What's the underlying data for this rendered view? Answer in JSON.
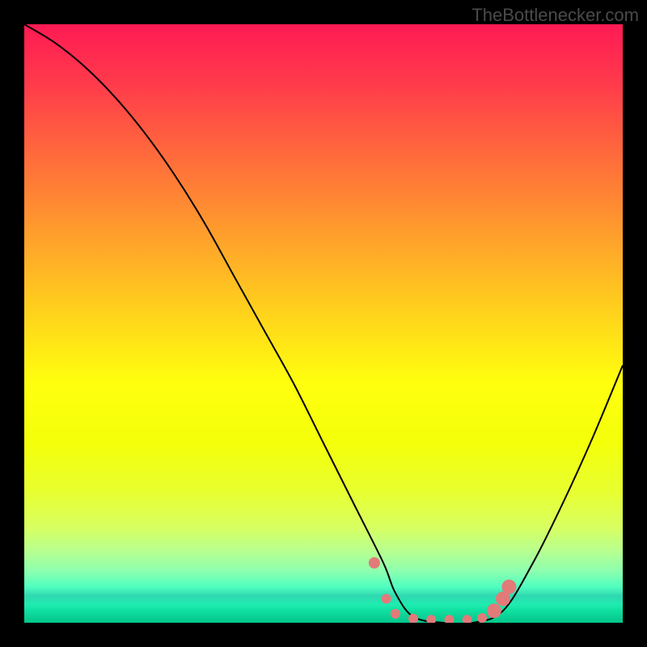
{
  "watermark": "TheBottlenecker.com",
  "chart_data": {
    "type": "line",
    "title": "",
    "xlabel": "",
    "ylabel": "",
    "xlim": [
      0,
      100
    ],
    "ylim": [
      0,
      100
    ],
    "series": [
      {
        "name": "curve",
        "x": [
          0,
          5,
          10,
          15,
          20,
          25,
          30,
          35,
          40,
          45,
          50,
          55,
          60,
          62,
          65,
          70,
          75,
          80,
          85,
          90,
          95,
          100
        ],
        "values": [
          100,
          97,
          93,
          88,
          82,
          75,
          67,
          58,
          49,
          40,
          30,
          20,
          10,
          5,
          1,
          0,
          0,
          2,
          10,
          20,
          31,
          43
        ]
      }
    ],
    "markers": {
      "color": "#e27a7a",
      "points": [
        {
          "x": 58.5,
          "y": 10
        },
        {
          "x": 60.5,
          "y": 4
        },
        {
          "x": 62,
          "y": 1.5
        },
        {
          "x": 65,
          "y": 0.7
        },
        {
          "x": 68,
          "y": 0.5
        },
        {
          "x": 71,
          "y": 0.5
        },
        {
          "x": 74,
          "y": 0.5
        },
        {
          "x": 76.5,
          "y": 0.8
        },
        {
          "x": 78.5,
          "y": 2
        },
        {
          "x": 80,
          "y": 4
        },
        {
          "x": 81,
          "y": 6
        }
      ]
    }
  }
}
